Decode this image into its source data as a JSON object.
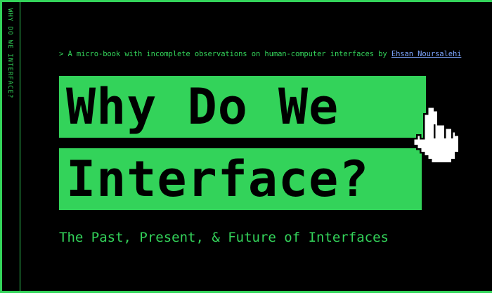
{
  "side_label": "WHY DO WE INTERFACE?",
  "intro": {
    "text": "> A micro-book with incomplete observations on human-computer interfaces by ",
    "author_link": "Ehsan Noursalehi"
  },
  "title": {
    "line1": "Why Do We",
    "line2": "Interface?"
  },
  "subtitle": "The Past, Present, & Future of Interfaces",
  "icons": {
    "cursor": "pointer-hand-icon"
  },
  "colors": {
    "background": "#000000",
    "accent": "#33d35a",
    "link": "#7da6ff"
  }
}
